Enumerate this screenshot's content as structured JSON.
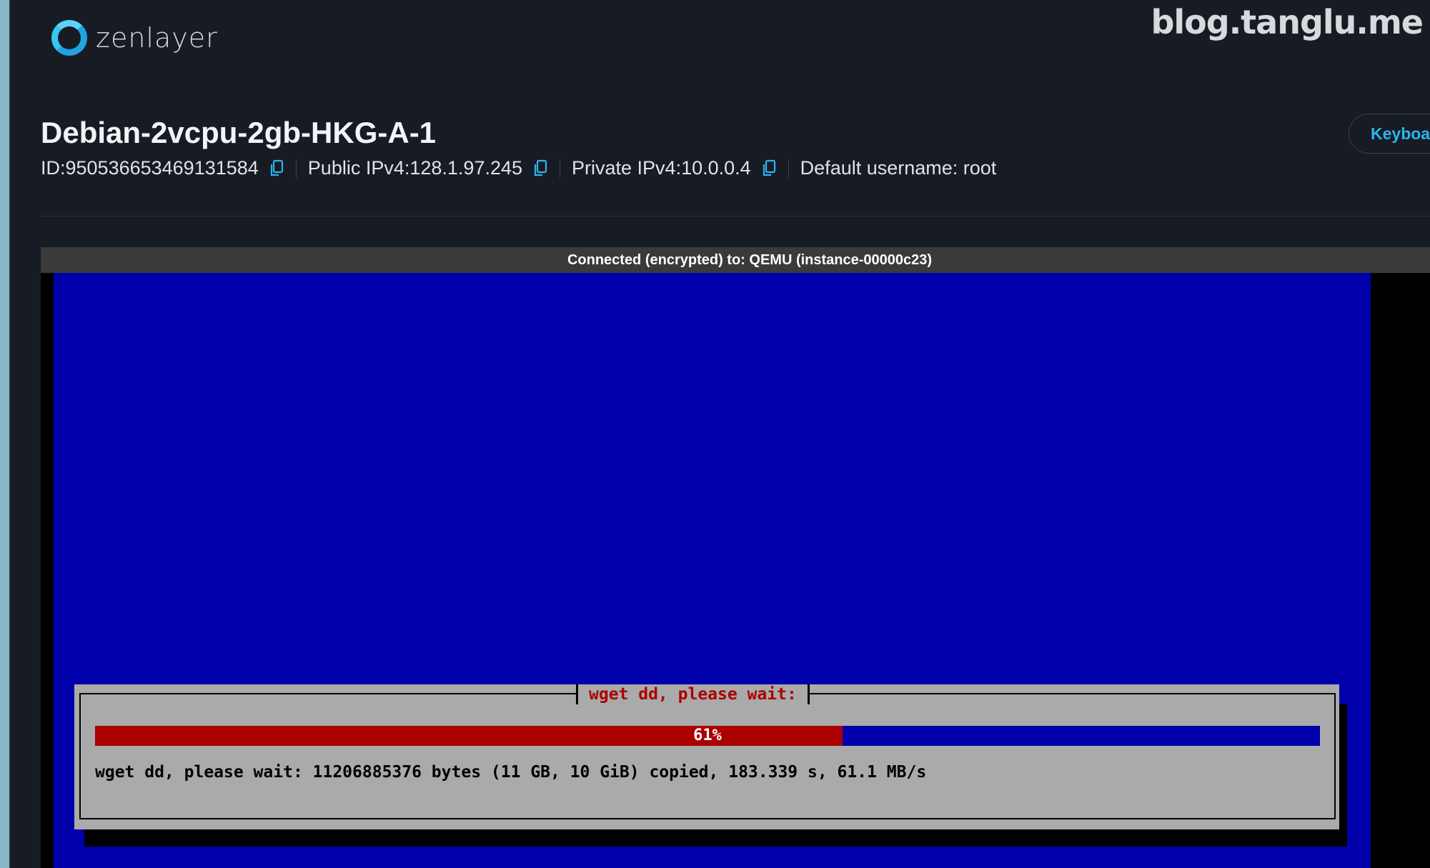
{
  "brand": {
    "logo_text": "zenlayer",
    "watermark": "blog.tanglu.me",
    "accent": "#1fa6e0"
  },
  "instance": {
    "title": "Debian-2vcpu-2gb-HKG-A-1",
    "id": "ID:950536653469131584",
    "public_ip": "Public IPv4:128.1.97.245",
    "private_ip": "Private IPv4:10.0.0.4",
    "username": "Default username: root"
  },
  "header": {
    "keyboard_button": "Keyboa"
  },
  "console": {
    "status": "Connected (encrypted) to: QEMU (instance-00000c23)",
    "screen_color": "#0000aa",
    "dialog": {
      "title": "wget dd, please wait:",
      "progress_percent": 61,
      "progress_label": "61%",
      "message": "wget dd, please wait: 11206885376 bytes (11 GB, 10 GiB) copied, 183.339 s, 61.1 MB/s"
    }
  },
  "icons": {
    "copy": "copy-icon"
  }
}
